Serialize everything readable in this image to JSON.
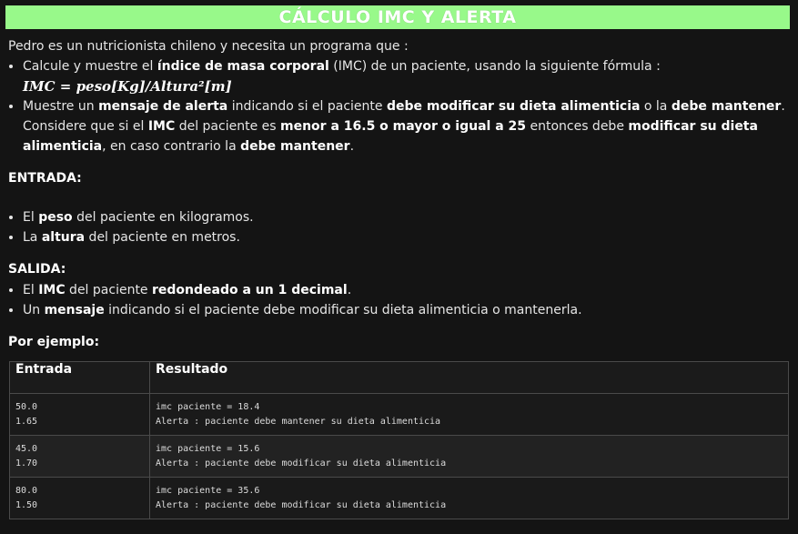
{
  "title": "CÁLCULO IMC Y ALERTA",
  "intro": "Pedro es un nutricionista chileno y necesita un programa que :",
  "bullets": {
    "b1_pre": "Calcule y muestre el ",
    "b1_bold": "índice de masa corporal",
    "b1_post": " (IMC) de un paciente, usando la siguiente fórmula :",
    "formula": "IMC = peso[Kg]/Altura²[m]",
    "b2_pre": "Muestre un ",
    "b2_bold1": "mensaje de alerta",
    "b2_mid1": " indicando si el paciente ",
    "b2_bold2": "debe modificar su dieta alimenticia",
    "b2_mid2": " o la ",
    "b2_bold3": "debe mantener",
    "b2_mid3": ". Considere que si el ",
    "b2_bold4": "IMC",
    "b2_mid4": " del paciente es ",
    "b2_bold5": "menor a 16.5 o mayor o igual a 25",
    "b2_mid5": " entonces debe ",
    "b2_bold6": "modificar su dieta alimenticia",
    "b2_mid6": ", en caso contrario la ",
    "b2_bold7": "debe mantener",
    "b2_end": "."
  },
  "entrada": {
    "heading": "ENTRADA:",
    "i1_pre": "El ",
    "i1_bold": "peso",
    "i1_post": " del paciente en kilogramos.",
    "i2_pre": "La ",
    "i2_bold": "altura",
    "i2_post": " del paciente en metros."
  },
  "salida": {
    "heading": "SALIDA:",
    "o1_pre": "El ",
    "o1_bold1": "IMC",
    "o1_mid": " del paciente ",
    "o1_bold2": "redondeado a un 1 decimal",
    "o1_end": ".",
    "o2_pre": "Un ",
    "o2_bold": "mensaje",
    "o2_post": " indicando si el paciente debe modificar su dieta alimenticia o mantenerla."
  },
  "example_heading": "Por ejemplo:",
  "table": {
    "headers": [
      "Entrada",
      "Resultado"
    ],
    "rows": [
      {
        "entrada": "50.0\n1.65",
        "resultado": "imc paciente = 18.4\nAlerta : paciente debe mantener su dieta alimenticia"
      },
      {
        "entrada": "45.0\n1.70",
        "resultado": "imc paciente = 15.6\nAlerta : paciente debe modificar su dieta alimenticia"
      },
      {
        "entrada": "80.0\n1.50",
        "resultado": "imc paciente = 35.6\nAlerta : paciente debe modificar su dieta alimenticia"
      }
    ]
  },
  "colors": {
    "title_bg": "#98f98a",
    "page_bg": "#141414"
  }
}
